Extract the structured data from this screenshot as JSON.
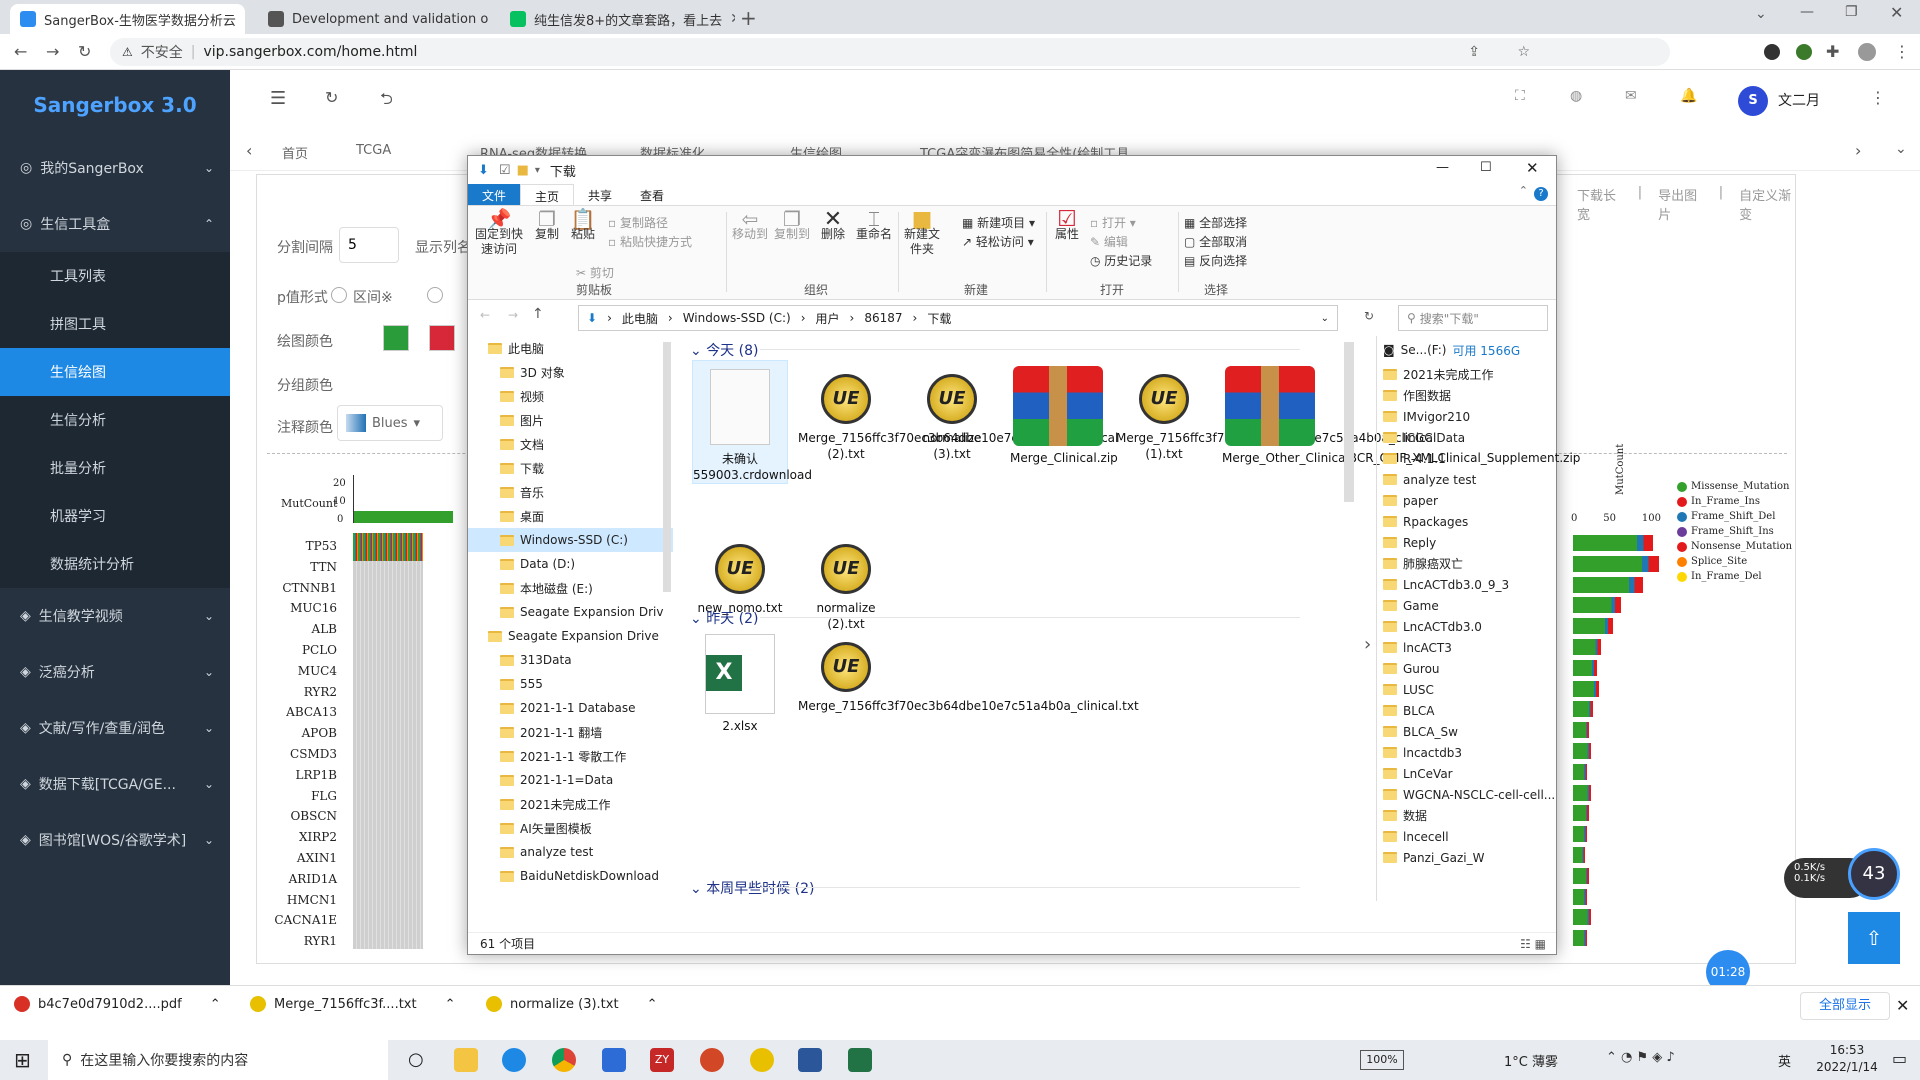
{
  "browser": {
    "tabs": [
      {
        "title": "SangerBox-生物医学数据分析云",
        "active": true,
        "color": "#2d8cf0"
      },
      {
        "title": "Development and validation o",
        "active": false,
        "color": "#555"
      },
      {
        "title": "纯生信发8+的文章套路，看上去",
        "active": false,
        "color": "#07c160"
      }
    ],
    "security": "不安全",
    "url": "vip.sangerbox.com/home.html"
  },
  "sidebar": {
    "brand": "Sangerbox 3.0",
    "sections": [
      {
        "label": "我的SangerBox",
        "chev": "⌄"
      },
      {
        "label": "生信工具盒",
        "chev": "⌃"
      }
    ],
    "subitems": [
      "工具列表",
      "拼图工具",
      "生信绘图",
      "生信分析",
      "批量分析",
      "机器学习",
      "数据统计分析"
    ],
    "active_sub": "生信绘图",
    "more": [
      "生信教学视频",
      "泛癌分析",
      "文献/写作/查重/润色",
      "数据下载[TCGA/GE...",
      "图书馆[WOS/谷歌学术]"
    ]
  },
  "app": {
    "user": "文二月",
    "tabs": [
      "首页",
      "TCGA",
      "RNA-seq数据转换",
      "数据标准化",
      "生信绘图",
      "TCGA突变瀑布图简易全性(绘制工具"
    ],
    "toolbar": [
      "下载长宽",
      "导出图片",
      "自定义渐变"
    ],
    "form": {
      "split_label": "分割间隔",
      "split_value": "5",
      "display_label": "显示列名",
      "pformat_label": "p值形式",
      "interval_label": "区间※",
      "color_label": "绘图颜色",
      "group_color_label": "分组颜色",
      "annot_color_label": "注释颜色",
      "palette": "Blues"
    },
    "plot": {
      "mutcount": "MutCount",
      "tick20": "20",
      "tick10": "10",
      "tick0": "0",
      "genes": [
        "TP53",
        "TTN",
        "CTNNB1",
        "MUC16",
        "ALB",
        "PCLO",
        "MUC4",
        "RYR2",
        "ABCA13",
        "APOB",
        "CSMD3",
        "LRP1B",
        "FLG",
        "OBSCN",
        "XIRP2",
        "AXIN1",
        "ARID1A",
        "HMCN1",
        "CACNA1E",
        "RYR1"
      ],
      "legend": [
        {
          "label": "Missense_Mutation",
          "color": "#33a02c"
        },
        {
          "label": "In_Frame_Ins",
          "color": "#e31a1c"
        },
        {
          "label": "Frame_Shift_Del",
          "color": "#1f78b4"
        },
        {
          "label": "Frame_Shift_Ins",
          "color": "#6a3d9a"
        },
        {
          "label": "Nonsense_Mutation",
          "color": "#e31a1c"
        },
        {
          "label": "Splice_Site",
          "color": "#ff7f00"
        },
        {
          "label": "In_Frame_Del",
          "color": "#ffd700"
        }
      ],
      "bar_axis": [
        "0",
        "50",
        "100"
      ],
      "bar_title": "MutCount"
    }
  },
  "explorer": {
    "title": "下载",
    "ribbon_tabs": [
      "文件",
      "主页",
      "共享",
      "查看"
    ],
    "ribbon": {
      "pin": "固定到快速访问",
      "copy": "复制",
      "paste": "粘贴",
      "copy_path": "复制路径",
      "paste_shortcut": "粘贴快捷方式",
      "cut": "剪切",
      "move_to": "移动到",
      "copy_to": "复制到",
      "delete": "删除",
      "rename": "重命名",
      "new_folder": "新建文件夹",
      "new_item": "新建项目",
      "easy_access": "轻松访问",
      "properties": "属性",
      "open": "打开",
      "edit": "编辑",
      "history": "历史记录",
      "select_all": "全部选择",
      "select_none": "全部取消",
      "invert": "反向选择",
      "groups": [
        "剪贴板",
        "组织",
        "新建",
        "打开",
        "选择"
      ]
    },
    "path": [
      "此电脑",
      "Windows-SSD (C:)",
      "用户",
      "86187",
      "下载"
    ],
    "search_placeholder": "搜索\"下载\"",
    "nav": [
      {
        "label": "此电脑",
        "indent": 0
      },
      {
        "label": "3D 对象",
        "indent": 1
      },
      {
        "label": "视频",
        "indent": 1
      },
      {
        "label": "图片",
        "indent": 1
      },
      {
        "label": "文档",
        "indent": 1
      },
      {
        "label": "下载",
        "indent": 1
      },
      {
        "label": "音乐",
        "indent": 1
      },
      {
        "label": "桌面",
        "indent": 1
      },
      {
        "label": "Windows-SSD (C:)",
        "indent": 1,
        "sel": true
      },
      {
        "label": "Data (D:)",
        "indent": 1
      },
      {
        "label": "本地磁盘 (E:)",
        "indent": 1
      },
      {
        "label": "Seagate Expansion Driv",
        "indent": 1
      },
      {
        "label": "Seagate Expansion Drive",
        "indent": 0
      },
      {
        "label": "313Data",
        "indent": 1
      },
      {
        "label": "555",
        "indent": 1
      },
      {
        "label": "2021-1-1 Database",
        "indent": 1
      },
      {
        "label": "2021-1-1 翻墙",
        "indent": 1
      },
      {
        "label": "2021-1-1 零散工作",
        "indent": 1
      },
      {
        "label": "2021-1-1=Data",
        "indent": 1
      },
      {
        "label": "2021未完成工作",
        "indent": 1
      },
      {
        "label": "AI矢量图模板",
        "indent": 1
      },
      {
        "label": "analyze test",
        "indent": 1
      },
      {
        "label": "BaiduNetdiskDownload",
        "indent": 1
      }
    ],
    "groups": [
      {
        "label": "今天 (8)"
      },
      {
        "label": "昨天 (2)"
      },
      {
        "label": "本周早些时候 (2)"
      }
    ],
    "files_today": [
      {
        "name": "未确认 559003.crdownload",
        "type": "blank"
      },
      {
        "name": "Merge_7156ffc3f70ec3b64dbe10e7c51a4b0a_clinical (2).txt",
        "type": "ue"
      },
      {
        "name": "normalize (3).txt",
        "type": "ue"
      },
      {
        "name": "Merge_Clinical.zip",
        "type": "rar"
      },
      {
        "name": "Merge_7156ffc3f70ec3b64dbe10e7c51a4b0a_clinical (1).txt",
        "type": "ue"
      },
      {
        "name": "Merge_Other_ClinicalBCR_OMF_XMLClinical_Supplement.zip",
        "type": "rar"
      },
      {
        "name": "new_nomo.txt",
        "type": "ue"
      },
      {
        "name": "normalize (2).txt",
        "type": "ue"
      }
    ],
    "files_yesterday": [
      {
        "name": "2.xlsx",
        "type": "xlsx"
      },
      {
        "name": "Merge_7156ffc3f70ec3b64dbe10e7c51a4b0a_clinical.txt",
        "type": "ue"
      }
    ],
    "right_header": "Se...(F:)",
    "right_free": "可用 1566G",
    "right_folders": [
      "2021未完成工作",
      "作图数据",
      "IMvigor210",
      "ICGC Data",
      "R-4.1.1",
      "analyze test",
      "paper",
      "Rpackages",
      "Reply",
      "肺腺癌双亡",
      "LncACTdb3.0_9_3",
      "Game",
      "LncACTdb3.0",
      "lncACT3",
      "Gurou",
      "LUSC",
      "BLCA",
      "BLCA_Sw",
      "lncactdb3",
      "LnCeVar",
      "WGCNA-NSCLC-cell-cell...",
      "数据",
      "lncecell",
      "Panzi_Gazi_W"
    ],
    "status": "61 个项目"
  },
  "downloads": [
    {
      "name": "b4c7e0d7910d2....pdf"
    },
    {
      "name": "Merge_7156ffc3f....txt"
    },
    {
      "name": "normalize (3).txt"
    }
  ],
  "download_showall": "全部显示",
  "widget": {
    "up": "0.5K/s",
    "down": "0.1K/s",
    "pct": "43",
    "timer": "01:28"
  },
  "taskbar": {
    "search_placeholder": "在这里输入你要搜索的内容",
    "battery": "100%",
    "weather": "1°C 薄雾",
    "ime": "英",
    "time": "16:53",
    "date": "2022/1/14"
  }
}
